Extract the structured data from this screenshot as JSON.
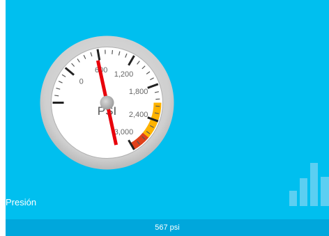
{
  "tile": {
    "label": "Presión",
    "footer_value": "567 psi",
    "colors": {
      "background": "#00BFEF",
      "footer": "#00A7DC",
      "needle": "#E8000B",
      "band_yellow": "#FFB300",
      "band_orange": "#FF8A00",
      "band_red": "#E0401A"
    }
  },
  "gauge": {
    "unit": "PSI",
    "value": 567,
    "min": -600,
    "max": 3000,
    "tick_labels": [
      "600",
      "1,200",
      "1,800",
      "2,400",
      "3,000",
      "0"
    ],
    "warning_band": {
      "from": 2100,
      "to": 2700
    },
    "danger_band": {
      "from": 2700,
      "to": 3000
    }
  },
  "icons": {
    "trend": "bar-chart-icon"
  }
}
